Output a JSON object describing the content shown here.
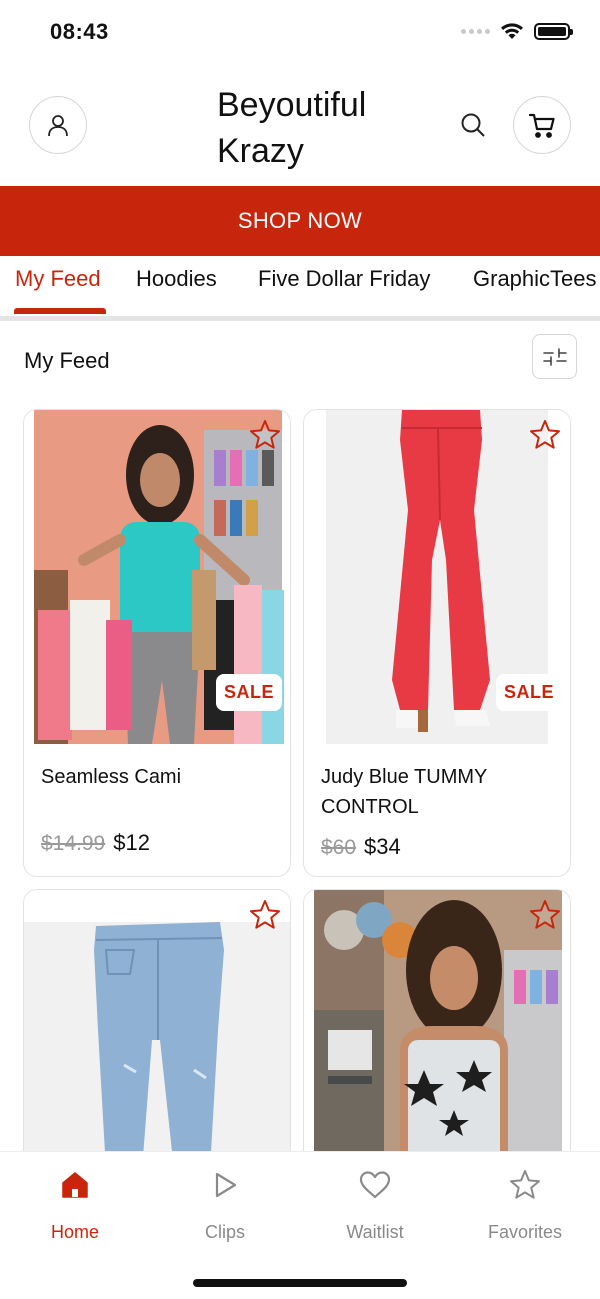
{
  "status_bar": {
    "time": "08:43"
  },
  "header": {
    "title": "Beyoutiful Krazy"
  },
  "banner": {
    "label": "SHOP NOW"
  },
  "tabs": [
    {
      "label": "My Feed",
      "active": true
    },
    {
      "label": "Hoodies",
      "active": false
    },
    {
      "label": "Five Dollar Friday",
      "active": false
    },
    {
      "label": "GraphicTees",
      "active": false
    }
  ],
  "section": {
    "title": "My Feed"
  },
  "products": [
    {
      "name": "Seamless Cami",
      "old_price": "$14.99",
      "price": "$12",
      "badge": "SALE"
    },
    {
      "name": "Judy Blue TUMMY CONTROL",
      "old_price": "$60",
      "price": "$34",
      "badge": "SALE"
    },
    {
      "name": "",
      "old_price": "",
      "price": "",
      "badge": ""
    },
    {
      "name": "",
      "old_price": "",
      "price": "",
      "badge": ""
    }
  ],
  "bottom_nav": [
    {
      "label": "Home",
      "icon": "home-icon",
      "active": true
    },
    {
      "label": "Clips",
      "icon": "play-icon",
      "active": false
    },
    {
      "label": "Waitlist",
      "icon": "heart-icon",
      "active": false
    },
    {
      "label": "Favorites",
      "icon": "star-icon",
      "active": false
    }
  ],
  "colors": {
    "accent": "#c8260c",
    "inactive": "#8a8a8a"
  }
}
